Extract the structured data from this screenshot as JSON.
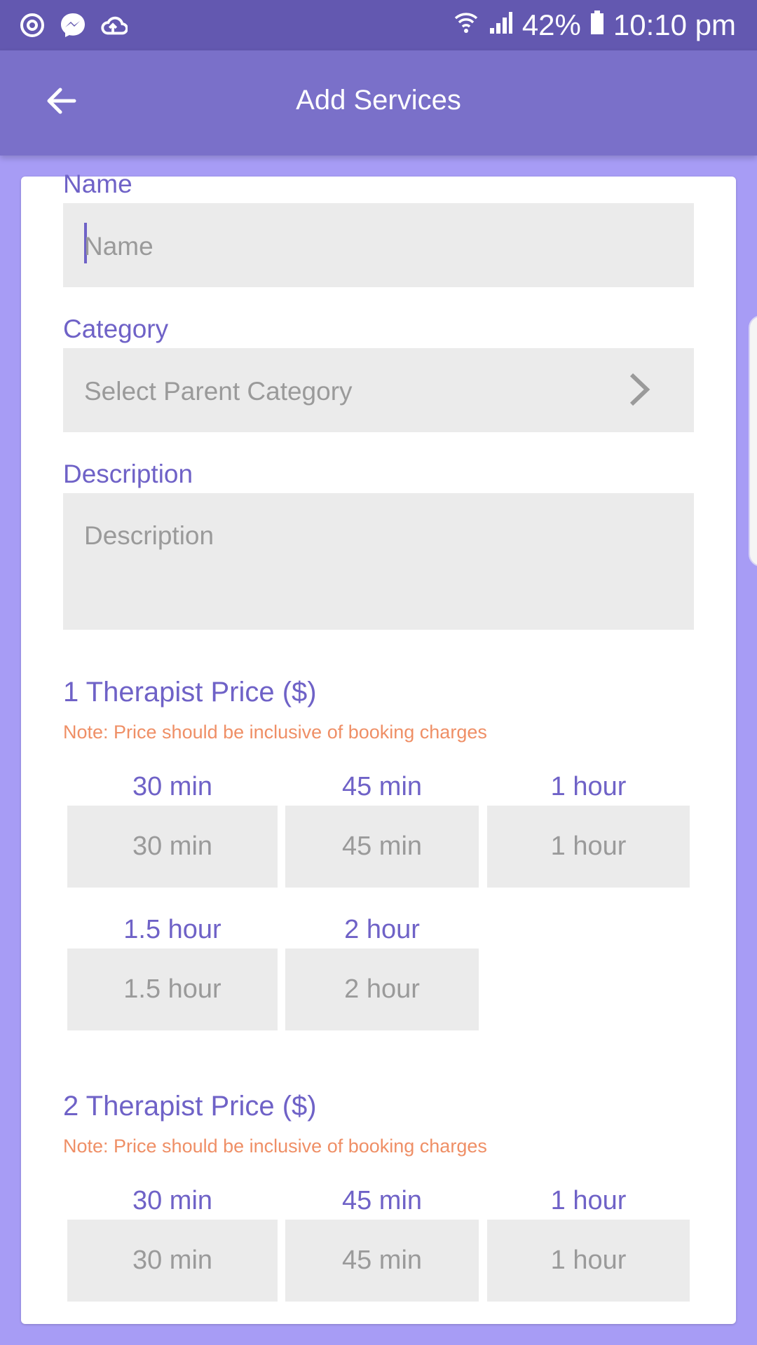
{
  "status_bar": {
    "left_icons": [
      "alarm-icon",
      "messenger-icon",
      "cloud-upload-icon"
    ],
    "battery": "42%",
    "time": "10:10 pm"
  },
  "app_bar": {
    "title": "Add Services",
    "back_icon": "arrow-left-icon"
  },
  "form": {
    "name": {
      "label": "Name",
      "placeholder": "Name"
    },
    "category": {
      "label": "Category",
      "placeholder": "Select Parent Category"
    },
    "description": {
      "label": "Description",
      "placeholder": "Description"
    }
  },
  "pricing": [
    {
      "title": "1 Therapist Price ($)",
      "note": "Note: Price should be inclusive of booking charges",
      "options": [
        "30 min",
        "45 min",
        "1 hour",
        "1.5 hour",
        "2 hour"
      ]
    },
    {
      "title": "2 Therapist Price ($)",
      "note": "Note: Price should be inclusive of booking charges",
      "options": [
        "30 min",
        "45 min",
        "1 hour"
      ]
    }
  ],
  "colors": {
    "accent": "#6f62c7",
    "appbar": "#7a70c9",
    "statusbar": "#6358b0",
    "background": "#a79cf5",
    "note": "#ef8f66",
    "field": "#ebebeb"
  }
}
